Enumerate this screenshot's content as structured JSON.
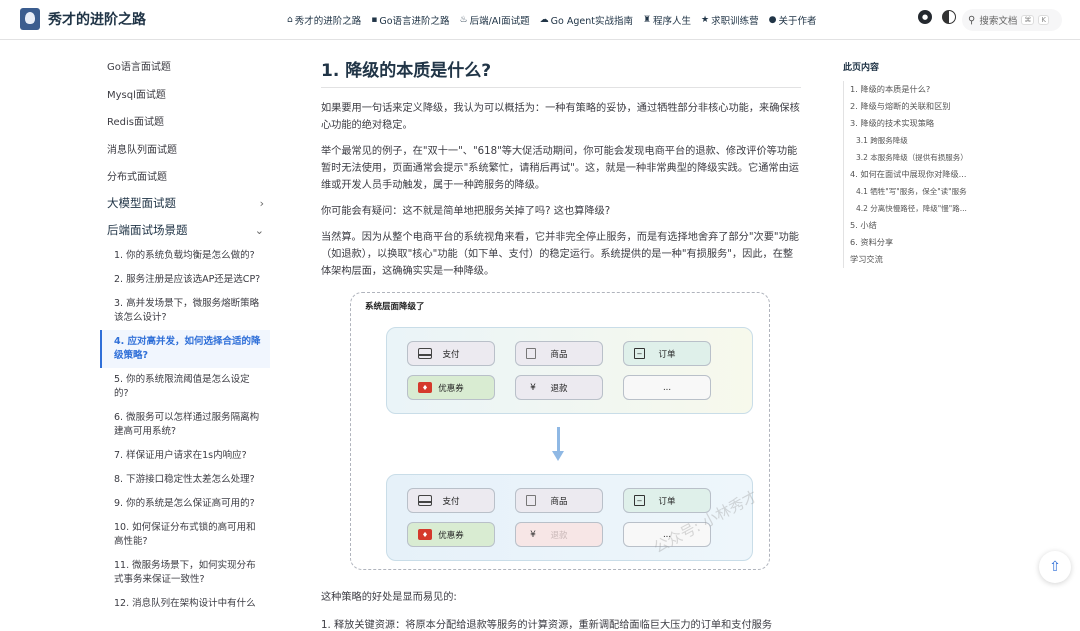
{
  "brand": {
    "title": "秀才的进阶之路"
  },
  "nav": [
    {
      "icon": "⌂",
      "label": "秀才的进阶之路"
    },
    {
      "icon": "▪",
      "label": "Go语言进阶之路"
    },
    {
      "icon": "♨",
      "label": "后端/AI面试题"
    },
    {
      "icon": "☁",
      "label": "Go Agent实战指南"
    },
    {
      "icon": "♜",
      "label": "程序人生"
    },
    {
      "icon": "★",
      "label": "求职训练营"
    },
    {
      "icon": "●",
      "label": "关于作者"
    }
  ],
  "search": {
    "placeholder": "搜索文档",
    "kbd1": "⌘",
    "kbd2": "K"
  },
  "sidebar": {
    "items": [
      "Go语言面试题",
      "Mysql面试题",
      "Redis面试题",
      "消息队列面试题",
      "分布式面试题"
    ],
    "group1": "大模型面试题",
    "group2": "后端面试场景题",
    "subs": [
      "1. 你的系统负载均衡是怎么做的?",
      "2. 服务注册是应该选AP还是选CP?",
      "3. 高并发场景下，微服务熔断策略该怎么设计?",
      "4. 应对高并发，如何选择合适的降级策略?",
      "5. 你的系统限流阈值是怎么设定的?",
      "6. 微服务可以怎样通过服务隔离构建高可用系统?",
      "7. 样保证用户请求在1s内响应?",
      "8. 下游接口稳定性太差怎么处理?",
      "9. 你的系统是怎么保证高可用的?",
      "10. 如何保证分布式锁的高可用和高性能?",
      "11. 微服务场景下，如何实现分布式事务来保证一致性?",
      "12. 消息队列在架构设计中有什么"
    ]
  },
  "article": {
    "heading": "1. 降级的本质是什么?",
    "p1": "如果要用一句话来定义降级，我认为可以概括为：一种有策略的妥协，通过牺牲部分非核心功能，来确保核心功能的绝对稳定。",
    "p2": "举个最常见的例子，在\"双十一\"、\"618\"等大促活动期间，你可能会发现电商平台的退款、修改评价等功能暂时无法使用，页面通常会提示\"系统繁忙，请稍后再试\"。这，就是一种非常典型的降级实践。它通常由运维或开发人员手动触发，属于一种跨服务的降级。",
    "p3": "你可能会有疑问：这不就是简单地把服务关掉了吗? 这也算降级?",
    "p4": "当然算。因为从整个电商平台的系统视角来看，它并非完全停止服务，而是有选择地舍弃了部分\"次要\"功能（如退款），以换取\"核心\"功能（如下单、支付）的稳定运行。系统提供的是一种\"有损服务\"，因此，在整体架构层面，这确确实实是一种降级。",
    "after": "这种策略的好处是显而易见的:",
    "after2": "1. 释放关键资源：将原本分配给退款等服务的计算资源，重新调配给面临巨大压力的订单和支付服务"
  },
  "diagram": {
    "title": "系统层面降级了",
    "pay": "支付",
    "goods": "商品",
    "order": "订单",
    "coupon": "优惠券",
    "refund": "退款",
    "more": "...",
    "yen": "¥",
    "watermark": "公众号: 小林秀才"
  },
  "toc": {
    "title": "此页内容",
    "items": [
      "1. 降级的本质是什么?",
      "2. 降级与熔断的关联和区别",
      "3. 降级的技术实现策略",
      "3.1 跨服务降级",
      "3.2 本服务降级（提供有损服务）",
      "4. 如何在面试中展现你对降级...",
      "4.1 牺牲\"写\"服务，保全\"读\"服务",
      "4.2 分离快慢路径，降级\"慢\"路...",
      "5. 小结",
      "6. 资料分享",
      "学习交流"
    ]
  }
}
